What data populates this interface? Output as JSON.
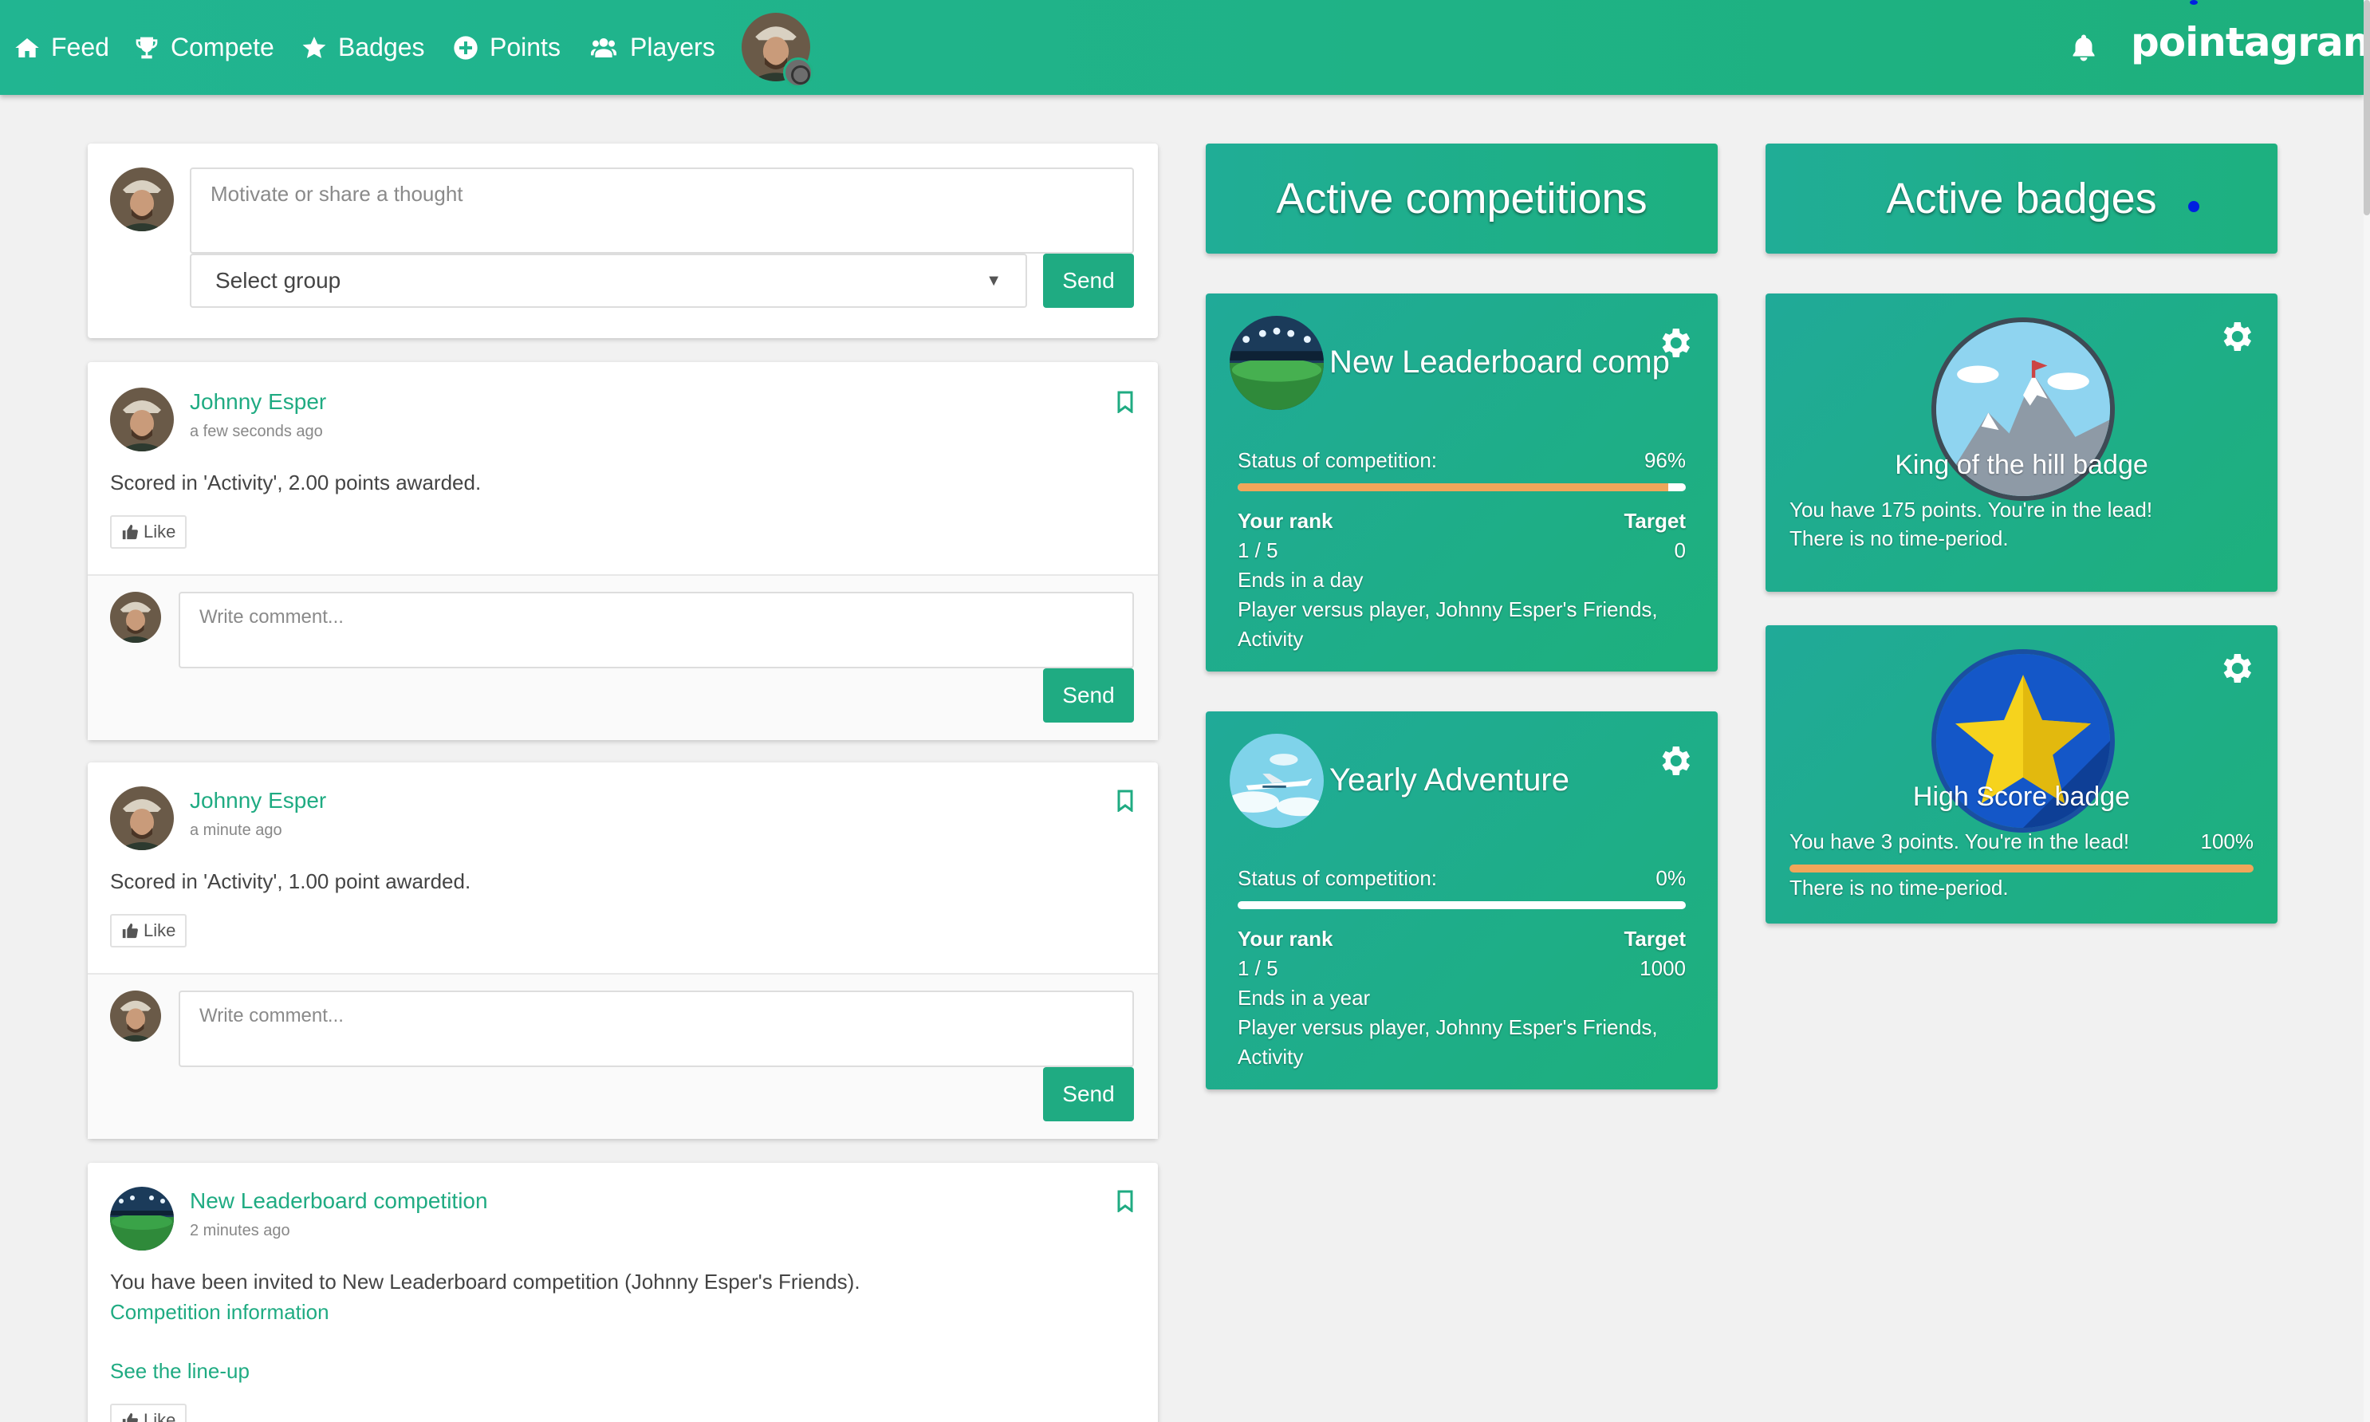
{
  "nav": {
    "items": [
      {
        "label": "Feed",
        "icon": "home-icon"
      },
      {
        "label": "Compete",
        "icon": "trophy-icon"
      },
      {
        "label": "Badges",
        "icon": "star-icon"
      },
      {
        "label": "Points",
        "icon": "plus-circle-icon"
      },
      {
        "label": "Players",
        "icon": "users-icon"
      }
    ],
    "brand": "pointagram"
  },
  "composer": {
    "placeholder": "Motivate or share a thought",
    "select_value": "Select group",
    "send_label": "Send"
  },
  "posts": [
    {
      "author": "Johnny Esper",
      "time": "a few seconds ago",
      "text": "Scored in 'Activity', 2.00 points awarded.",
      "like_label": "Like",
      "comment_placeholder": "Write comment...",
      "send_label": "Send"
    },
    {
      "author": "Johnny Esper",
      "time": "a minute ago",
      "text": "Scored in 'Activity', 1.00 point awarded.",
      "like_label": "Like",
      "comment_placeholder": "Write comment...",
      "send_label": "Send"
    },
    {
      "author": "New Leaderboard competition",
      "time": "2 minutes ago",
      "text": "You have been invited to New Leaderboard competition (Johnny Esper's Friends).",
      "link1": "Competition information",
      "link2": "See the line-up",
      "like_label": "Like"
    }
  ],
  "competitions": {
    "header": "Active competitions",
    "items": [
      {
        "title": "New Leaderboard comp",
        "status_label": "Status of competition:",
        "status_pct": "96%",
        "progress": 0.96,
        "rank_label": "Your rank",
        "rank": "1 / 5",
        "target_label": "Target",
        "target": "0",
        "ends": "Ends in a day",
        "desc_line1": "Player versus player, Johnny Esper's Friends,",
        "desc_line2": "Activity"
      },
      {
        "title": "Yearly Adventure",
        "status_label": "Status of competition:",
        "status_pct": "0%",
        "progress": 0.0,
        "rank_label": "Your rank",
        "rank": "1 / 5",
        "target_label": "Target",
        "target": "1000",
        "ends": "Ends in a year",
        "desc_line1": "Player versus player, Johnny Esper's Friends,",
        "desc_line2": "Activity"
      }
    ]
  },
  "badges": {
    "header": "Active badges",
    "items": [
      {
        "title": "King of the hill badge",
        "line1": "You have 175 points. You're in the lead!",
        "line2": "There is no time-period."
      },
      {
        "title": "High Score badge",
        "line1": "You have 3 points. You're in the lead!",
        "pct": "100%",
        "progress": 1.0,
        "line2": "There is no time-period."
      }
    ]
  },
  "colors": {
    "brand_green": "#1fb286",
    "accent_green": "#1fab82",
    "progress_orange": "#f0a65a"
  }
}
